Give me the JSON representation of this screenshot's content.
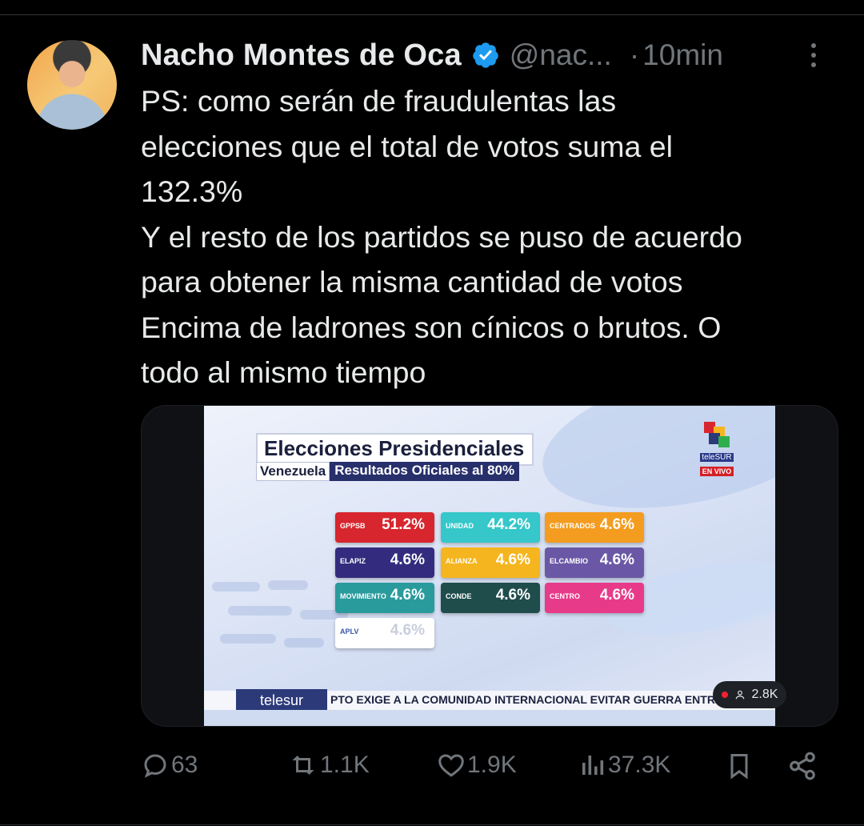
{
  "tweet": {
    "author_name": "Nacho Montes de Oca",
    "handle": "@nac...",
    "separator": "·",
    "time": "10min",
    "text_lines": [
      "PS: como serán de fraudulentas las",
      "elecciones que el total de votos suma el",
      "132.3%",
      "Y el resto de los partidos se puso de acuerdo",
      "para obtener la misma cantidad de votos",
      "Encima de ladrones son cínicos o brutos. O",
      "todo al mismo tiempo"
    ]
  },
  "media": {
    "title": "Elecciones Presidenciales",
    "country": "Venezuela",
    "subtitle": "Resultados Oficiales al 80%",
    "broadcaster": "teleSUR",
    "live_label": "EN VIVO",
    "tiles": [
      {
        "party": "GPPSB",
        "pct": "51.2%",
        "color": "#d7262e"
      },
      {
        "party": "UNIDAD",
        "pct": "44.2%",
        "color": "#35c7c9"
      },
      {
        "party": "CENTRADOS",
        "pct": "4.6%",
        "color": "#f39c1f"
      },
      {
        "party": "ELAPIZ",
        "pct": "4.6%",
        "color": "#332c7e"
      },
      {
        "party": "ALIANZA",
        "pct": "4.6%",
        "color": "#f5b51e"
      },
      {
        "party": "ELCAMBIO",
        "pct": "4.6%",
        "color": "#6a58a6"
      },
      {
        "party": "MOVIMIENTO",
        "pct": "4.6%",
        "color": "#2a9b9d"
      },
      {
        "party": "CONDE",
        "pct": "4.6%",
        "color": "#1f4d4c"
      },
      {
        "party": "CENTRO",
        "pct": "4.6%",
        "color": "#e73b8a"
      },
      {
        "party": "APLV",
        "pct": "4.6%",
        "color": "#ffffff"
      }
    ],
    "ticker_logo": "telesur",
    "ticker_text": "PTO EXIGE A LA COMUNIDAD INTERNACIONAL EVITAR GUERRA ENTRE ISRAEL Y LÍB",
    "view_count": "2.8K"
  },
  "actions": {
    "replies": "63",
    "reposts": "1.1K",
    "likes": "1.9K",
    "views": "37.3K"
  },
  "colors": {
    "background": "#000000",
    "text": "#e7e9ea",
    "muted": "#71767b",
    "verified": "#1d9bf0"
  }
}
